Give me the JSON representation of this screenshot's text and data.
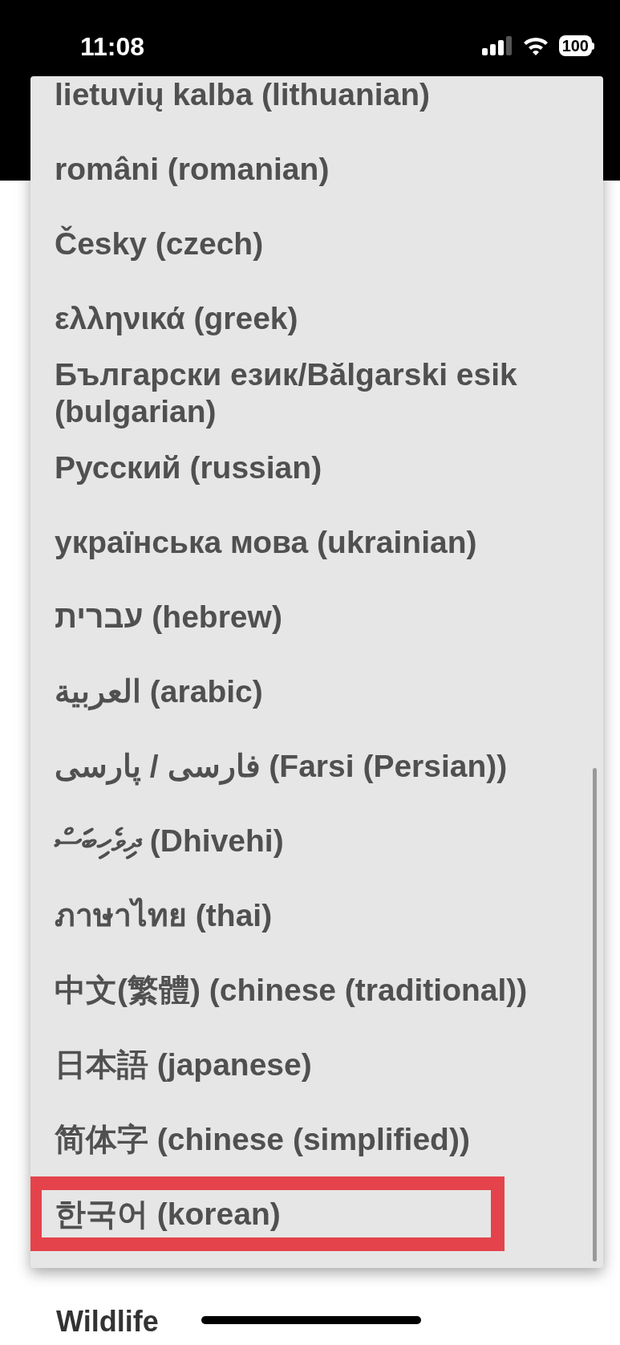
{
  "status_bar": {
    "time": "11:08",
    "battery": "100"
  },
  "page": {
    "heading": "Wildlife"
  },
  "language_menu": {
    "items": [
      {
        "label": "lietuvių kalba (lithuanian)",
        "selected": false
      },
      {
        "label": "români (romanian)",
        "selected": false
      },
      {
        "label": "Česky (czech)",
        "selected": false
      },
      {
        "label": "ελληνικά (greek)",
        "selected": false
      },
      {
        "label": "Български език/Bălgarski esik (bulgarian)",
        "selected": false
      },
      {
        "label": "Русский (russian)",
        "selected": false
      },
      {
        "label": "українська мова (ukrainian)",
        "selected": false
      },
      {
        "label": "עברית (hebrew)",
        "selected": false
      },
      {
        "label": "العربية  (arabic)",
        "selected": false
      },
      {
        "label": "فارسی / پارسی  (Farsi (Persian))",
        "selected": false
      },
      {
        "label": "ދިވެހިބަސް (Dhivehi)",
        "selected": false
      },
      {
        "label": "ภาษาไทย (thai)",
        "selected": false
      },
      {
        "label": "中文(繁體) (chinese (traditional))",
        "selected": false
      },
      {
        "label": "日本語 (japanese)",
        "selected": false
      },
      {
        "label": "简体字 (chinese (simplified))",
        "selected": false
      },
      {
        "label": "한국어 (korean)",
        "selected": true
      }
    ]
  }
}
